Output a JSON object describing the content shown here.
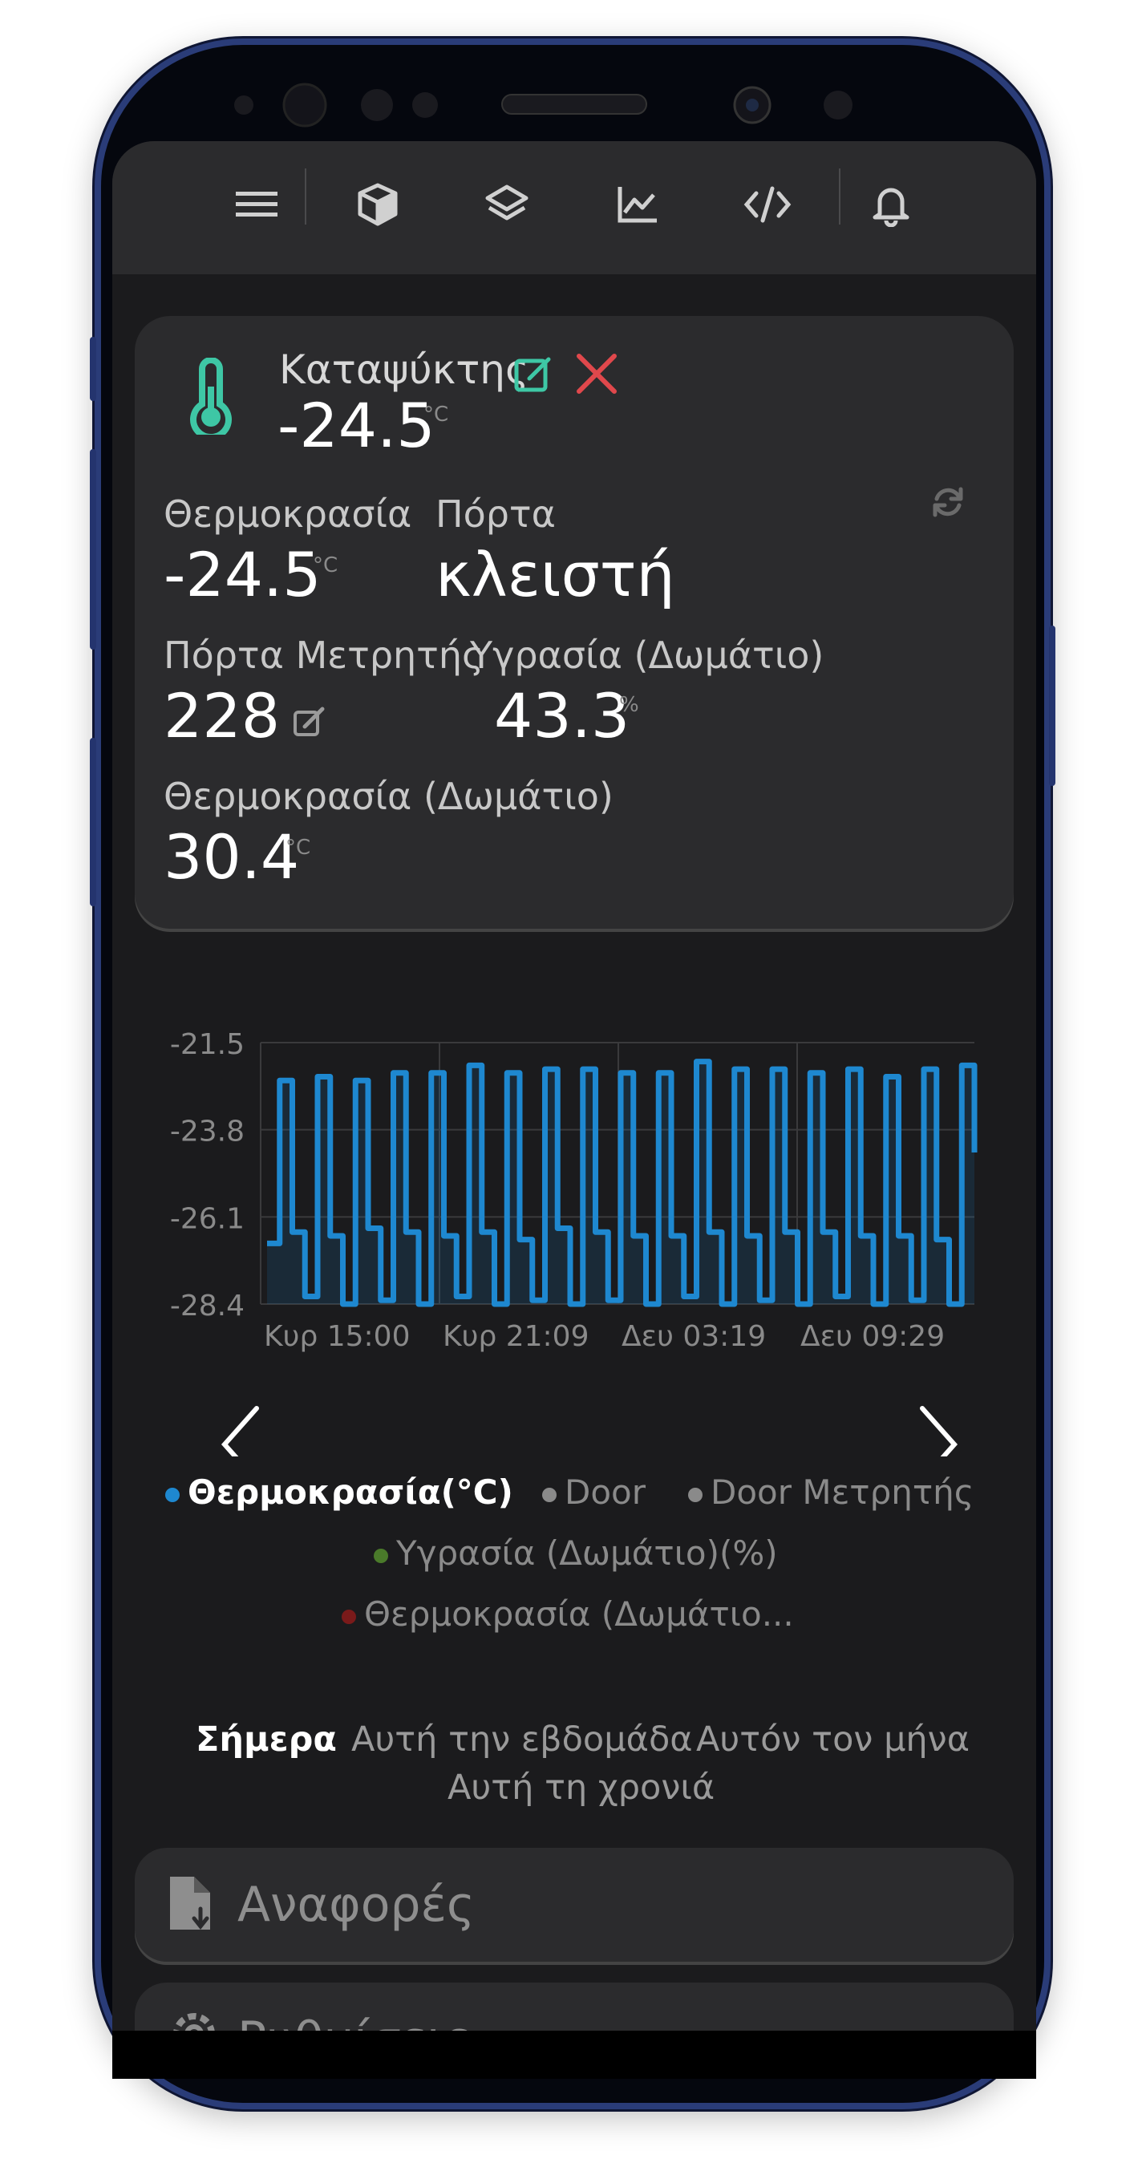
{
  "header": {
    "icons": [
      "menu-icon",
      "cube-icon",
      "layers-icon",
      "chart-icon",
      "code-icon",
      "bell-icon"
    ]
  },
  "device": {
    "name": "Καταψύκτης",
    "main_value": "-24.5",
    "main_unit": "°C",
    "colors": {
      "accent": "#3ec7a5",
      "close": "#e0484c"
    }
  },
  "readings": {
    "temperature": {
      "label": "Θερμοκρασία",
      "value": "-24.5",
      "unit": "°C"
    },
    "door": {
      "label": "Πόρτα",
      "value": "κλειστή"
    },
    "door_counter": {
      "label": "Πόρτα Μετρητής",
      "value": "228"
    },
    "room_humidity": {
      "label": "Υγρασία (Δωμάτιο)",
      "value": "43.3",
      "unit": "%"
    },
    "room_temperature": {
      "label": "Θερμοκρασία (Δωμάτιο)",
      "value": "30.4",
      "unit": "°C"
    }
  },
  "chart_data": {
    "type": "line",
    "y_ticks": [
      "-21.5",
      "-23.8",
      "-26.1",
      "-28.4"
    ],
    "x_ticks": [
      "Κυρ 15:00",
      "Κυρ 21:09",
      "Δευ 03:19",
      "Δευ 09:29"
    ],
    "ylim": [
      -28.4,
      -21.5
    ],
    "grid": true,
    "series": [
      {
        "name": "Θερμοκρασία(°C)",
        "color": "#1e88d0",
        "values": [
          -26.8,
          -22.5,
          -26.5,
          -28.2,
          -22.4,
          -26.6,
          -28.4,
          -22.5,
          -26.4,
          -28.3,
          -22.3,
          -26.5,
          -28.4,
          -22.3,
          -26.6,
          -28.2,
          -22.1,
          -26.5,
          -28.4,
          -22.3,
          -26.7,
          -28.3,
          -22.2,
          -26.4,
          -28.4,
          -22.2,
          -26.5,
          -28.3,
          -22.3,
          -26.6,
          -28.4,
          -22.3,
          -26.6,
          -28.2,
          -22.0,
          -26.5,
          -28.4,
          -22.2,
          -26.6,
          -28.3,
          -22.2,
          -26.5,
          -28.4,
          -22.3,
          -26.5,
          -28.2,
          -22.2,
          -26.6,
          -28.4,
          -22.4,
          -26.6,
          -28.3,
          -22.2,
          -26.7,
          -28.4,
          -22.1,
          -24.4
        ]
      }
    ]
  },
  "legend": [
    {
      "label": "Θερμοκρασία(°C)",
      "color": "#1e88d0",
      "active": true
    },
    {
      "label": "Door",
      "color": "#8a8a8a",
      "active": false
    },
    {
      "label": "Door Μετρητής",
      "color": "#8a8a8a",
      "active": false
    },
    {
      "label": "Υγρασία (Δωμάτιο)(%)",
      "color": "#4a7a2a",
      "active": false
    },
    {
      "label": "Θερμοκρασία (Δωμάτιο...",
      "color": "#7a1a1a",
      "active": false
    }
  ],
  "periods": [
    "Σήμερα",
    "Αυτή την εβδομάδα",
    "Αυτόν τον μήνα",
    "Αυτή τη χρονιά"
  ],
  "menu": {
    "reports": "Αναφορές",
    "settings": "Ρυθμίσεις"
  }
}
